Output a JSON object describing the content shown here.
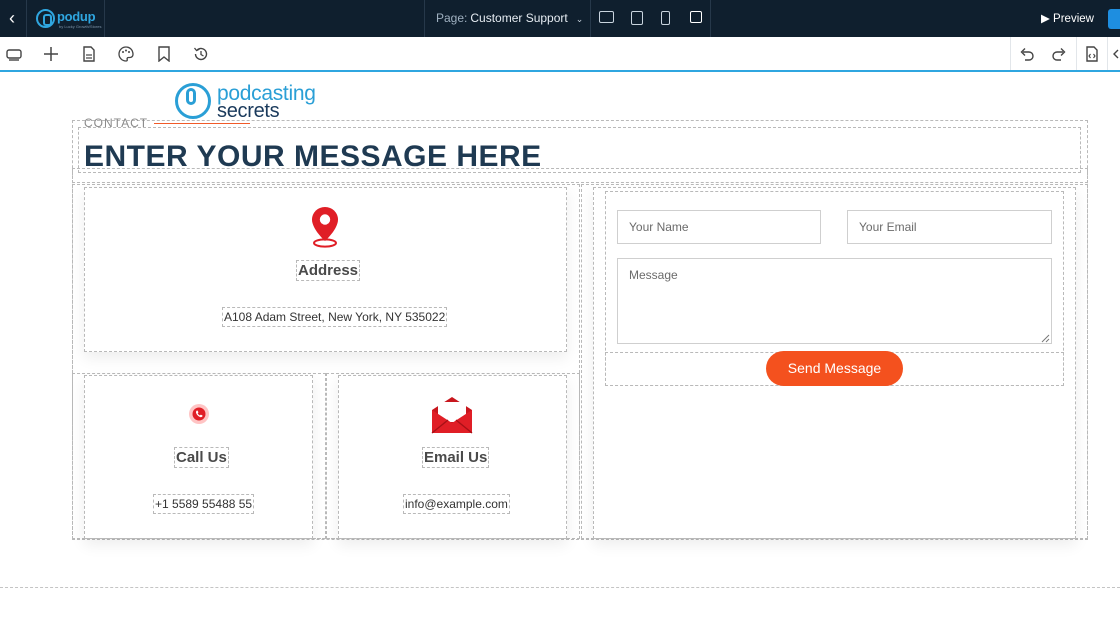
{
  "editor": {
    "brand_name": "podup",
    "brand_tagline": "by Lucky Growth/Stores",
    "page_label": "Page:",
    "page_name": "Customer Support",
    "preview_label": "Preview"
  },
  "site": {
    "logo_line1": "podcasting",
    "logo_line2": "secrets",
    "contact_label": "CONTACT",
    "heading": "ENTER YOUR MESSAGE HERE",
    "address": {
      "title": "Address",
      "text": "A108 Adam Street, New York, NY 535022"
    },
    "call": {
      "title": "Call Us",
      "text": "+1 5589 55488 55"
    },
    "email": {
      "title": "Email Us",
      "text": "info@example.com"
    },
    "form": {
      "name_placeholder": "Your Name",
      "email_placeholder": "Your Email",
      "message_placeholder": "Message",
      "send_label": "Send Message"
    }
  },
  "colors": {
    "accent": "#f4511e",
    "brand_blue": "#2a9fd6",
    "heading": "#1f3a52",
    "topbar": "#0f1f2e",
    "icon_red": "#e01e26"
  },
  "icons": {
    "address": "map-pin-icon",
    "call": "phone-icon",
    "email": "envelope-icon"
  }
}
